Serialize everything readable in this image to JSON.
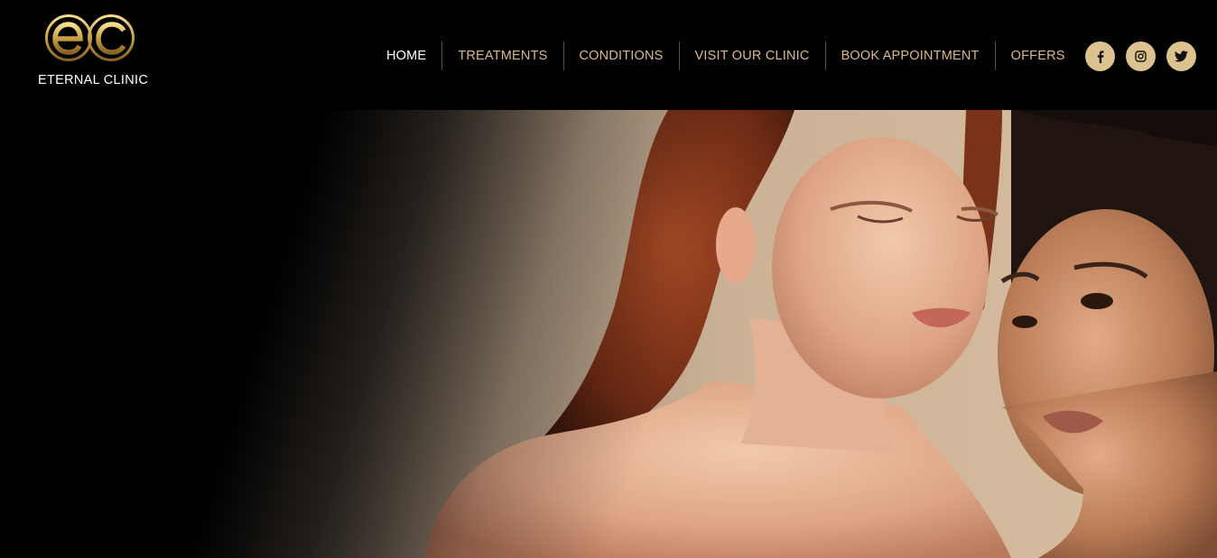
{
  "brand": {
    "name": "ETERNAL CLINIC",
    "logo_letters": "ec",
    "gold": "#c9a54e"
  },
  "nav": {
    "items": [
      {
        "label": "HOME",
        "active": true
      },
      {
        "label": "TREATMENTS",
        "active": false
      },
      {
        "label": "CONDITIONS",
        "active": false
      },
      {
        "label": "VISIT OUR CLINIC",
        "active": false
      },
      {
        "label": "BOOK APPOINTMENT",
        "active": false
      },
      {
        "label": "OFFERS",
        "active": false
      }
    ],
    "active_color": "#ffffff",
    "link_color": "#d9b98a"
  },
  "social": [
    {
      "icon": "facebook-icon"
    },
    {
      "icon": "instagram-icon"
    },
    {
      "icon": "twitter-icon"
    }
  ],
  "hero": {
    "image": "two-women-beauty-portrait",
    "backdrop_color": "#c8ad90"
  }
}
